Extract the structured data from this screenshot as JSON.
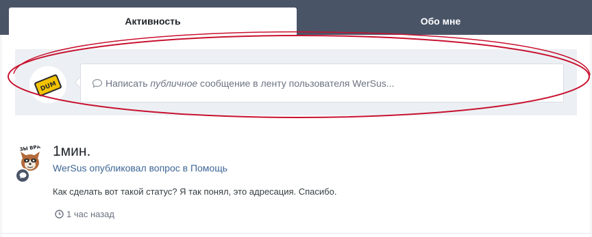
{
  "tabs": {
    "activity": "Активность",
    "about": "Обо мне"
  },
  "composer": {
    "prefix": "Написать ",
    "emphasis": "публичное",
    "suffix": " сообщение в ленту пользователя WerSus...",
    "avatar_icon": "dum-badge-avatar"
  },
  "feed": {
    "item": {
      "title": "1мин.",
      "subtitle": "WerSus опубликовал вопрос в Помощь",
      "body": "Как сделать вот такой статус? Я так понял, это адресация. Спасибо.",
      "time": "1 час назад",
      "badge_icon": "chat-bubble-icon",
      "avatar_icon": "raccoon-sticker-avatar",
      "avatar_caption": "ЗЫ ВРА"
    }
  },
  "colors": {
    "header_bg": "#4a5467",
    "composer_bg": "#ecf0f4",
    "annotation": "#c8102e",
    "link": "#3d6594"
  }
}
